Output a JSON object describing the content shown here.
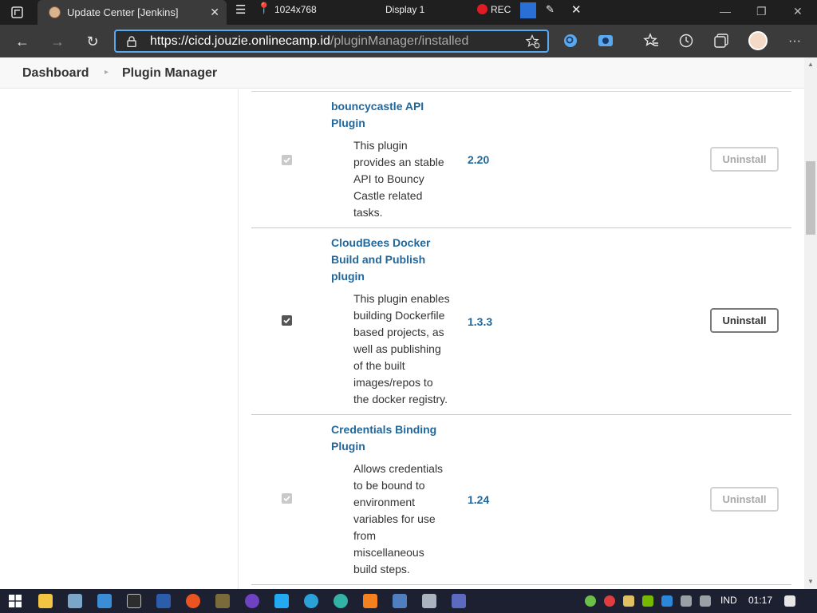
{
  "browser": {
    "tab_title": "Update Center [Jenkins]",
    "tab_close": "✕",
    "address": {
      "host": "https://cicd.jouzie.onlinecamp.id",
      "path": "/pluginManager/installed"
    },
    "recorder": {
      "resolution": "1024x768",
      "display": "Display 1",
      "rec_label": "REC"
    }
  },
  "breadcrumbs": {
    "items": [
      "Dashboard",
      "Plugin Manager"
    ],
    "separator": "›"
  },
  "plugins": [
    {
      "name_lines": [
        "bouncycastle API",
        "Plugin"
      ],
      "desc_lines": [
        "This plugin",
        "provides an stable",
        "API to Bouncy",
        "Castle related",
        "tasks."
      ],
      "version": "2.20",
      "checked": true,
      "disabled": true,
      "uninstall_label": "Uninstall"
    },
    {
      "name_lines": [
        "CloudBees Docker",
        "Build and Publish",
        "plugin"
      ],
      "desc_lines": [
        "This plugin enables",
        "building Dockerfile",
        "based projects, as",
        "well as publishing",
        "of the built",
        "images/repos to",
        "the docker registry."
      ],
      "version": "1.3.3",
      "checked": true,
      "disabled": false,
      "uninstall_label": "Uninstall"
    },
    {
      "name_lines": [
        "Credentials Binding",
        "Plugin"
      ],
      "desc_lines": [
        "Allows credentials",
        "to be bound to",
        "environment",
        "variables for use",
        "from",
        "miscellaneous",
        "build steps."
      ],
      "version": "1.24",
      "checked": true,
      "disabled": true,
      "uninstall_label": "Uninstall"
    }
  ],
  "taskbar": {
    "language": "IND",
    "time": "01:17"
  },
  "colors": {
    "link": "#21679b",
    "titlebar": "#1f1f1f",
    "toolbar": "#3b3b3b",
    "accent": "#5aa9f0"
  }
}
